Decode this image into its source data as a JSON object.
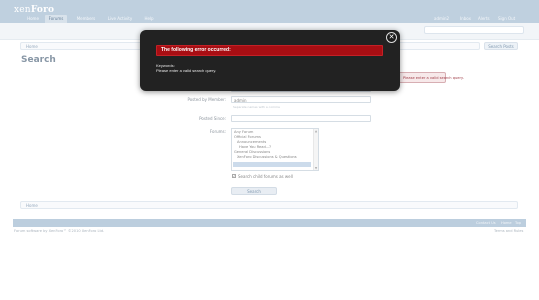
{
  "header": {
    "logo_prefix": "xen",
    "logo_suffix": "Foro"
  },
  "nav": {
    "tabs": [
      "Home",
      "Forums",
      "Members",
      "Live Activity",
      "Help"
    ],
    "active_index": 1,
    "user_links": [
      "admin2",
      "Inbox",
      "Alerts",
      "Sign Out"
    ]
  },
  "breadcrumb": {
    "label": "Home"
  },
  "search_button_top": "Search Posts",
  "page": {
    "title": "Search"
  },
  "form": {
    "keywords_label": "Keywords:",
    "posted_by_label": "Posted by Member:",
    "posted_by_value": "admin",
    "posted_by_hint": "Separate names with a comma",
    "newer_than_label": "Posted Since:",
    "forums_label": "Forums:",
    "forums": [
      {
        "label": "Any Forum",
        "selected": false
      },
      {
        "label": "Official Forums",
        "selected": false
      },
      {
        "label": "  Announcements",
        "selected": false
      },
      {
        "label": "  Have You Read...?",
        "selected": false
      },
      {
        "label": "General Discussions",
        "selected": false
      },
      {
        "label": "  XenForo Discussions & Questions",
        "selected": false
      },
      {
        "label": "",
        "selected": true
      }
    ],
    "child_forums_label": "Search child forums as well",
    "child_forums_checked": true,
    "submit_label": "Search"
  },
  "bottom_breadcrumb": {
    "label": "Home"
  },
  "footer": {
    "links": [
      "Contact Us",
      "Home",
      "Top"
    ],
    "copyright": "Forum software by XenForo™ ©2010 XenForo Ltd.",
    "terms": "Terms and Rules"
  },
  "background_error": {
    "text": "Please enter a valid search query."
  },
  "dialog": {
    "title": "The following error occurred:",
    "body_label": "Keywords:",
    "body_message": "Please enter a valid search query.",
    "close_glyph": "✕"
  },
  "colors": {
    "header": "#a7bed3",
    "dialog_bg": "#222222",
    "dialog_title_bg": "#a80e13"
  }
}
